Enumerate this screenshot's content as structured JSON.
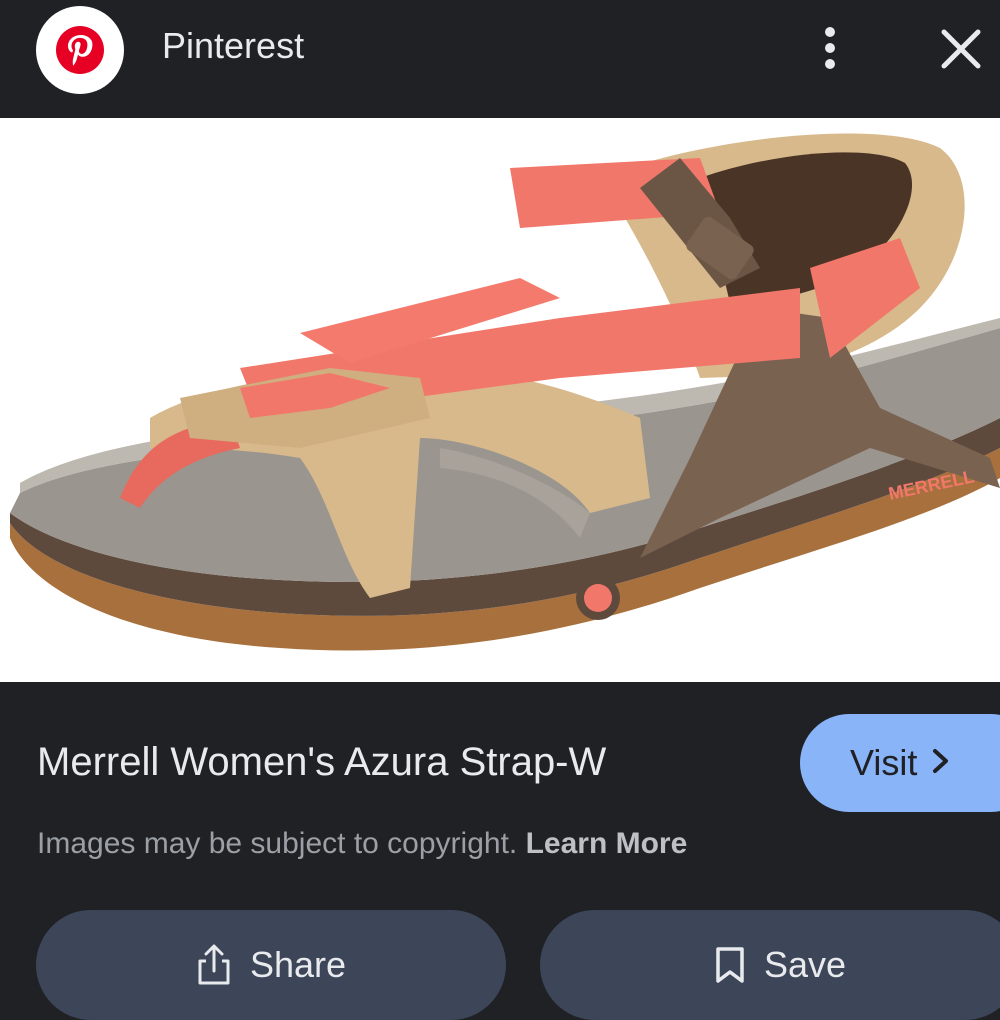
{
  "header": {
    "site_name": "Pinterest",
    "logo_icon": "pinterest-logo-icon",
    "more_icon": "more-vert-icon",
    "close_icon": "close-icon",
    "brand_color": "#e60023"
  },
  "image": {
    "brand_text": "MERRELL",
    "colors": {
      "background": "#ffffff",
      "strap": "#f2776b",
      "leather": "#d8b98c",
      "footbed": "#9a958e",
      "frame": "#7a6250",
      "sole": "#a8703c"
    }
  },
  "result": {
    "title": "Merrell Women's Azura Strap-W",
    "visit_label": "Visit",
    "visit_color": "#8ab4f8",
    "copyright_text": "Images may be subject to copyright.",
    "learn_more_label": "Learn More"
  },
  "actions": {
    "share_label": "Share",
    "save_label": "Save",
    "button_color": "#3c4658"
  }
}
